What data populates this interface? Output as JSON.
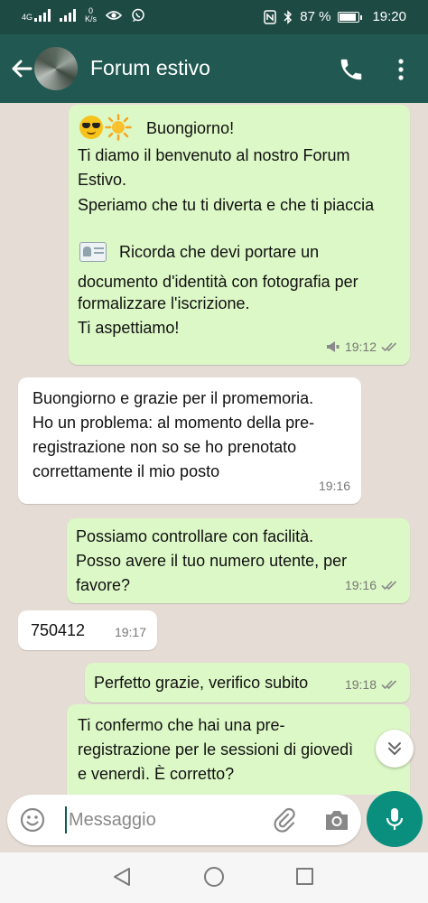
{
  "status_bar": {
    "network_label": "4G",
    "speed_value": "0",
    "speed_unit": "K/s",
    "battery_percent": "87 %",
    "battery_level": 0.87,
    "time": "19:20"
  },
  "header": {
    "title": "Forum estivo"
  },
  "messages": [
    {
      "direction": "outgoing",
      "lines": [
        "Buongiorno!",
        "Ti diamo il benvenuto al nostro Forum",
        "Estivo.",
        "Speriamo che tu ti diverta e che ti piaccia",
        "",
        "Ricorda che devi portare un",
        "documento d'identità con fotografia per",
        "formalizzare l'iscrizione.",
        "Ti aspettiamo!"
      ],
      "time": "19:12",
      "status": "read"
    },
    {
      "direction": "incoming",
      "lines": [
        "Buongiorno e grazie per il promemoria.",
        "Ho un problema: al momento della pre-",
        "registrazione non so se ho prenotato",
        "correttamente il mio posto"
      ],
      "time": "19:16"
    },
    {
      "direction": "outgoing",
      "lines": [
        "Possiamo controllare con facilità.",
        "Posso avere il tuo numero utente, per",
        "favore?"
      ],
      "time": "19:16",
      "status": "read"
    },
    {
      "direction": "incoming",
      "lines": [
        "750412"
      ],
      "time": "19:17"
    },
    {
      "direction": "outgoing",
      "lines": [
        "Perfetto grazie, verifico subito"
      ],
      "time": "19:18",
      "status": "read"
    },
    {
      "direction": "outgoing",
      "lines": [
        "Ti confermo che hai una pre-",
        "registrazione per le sessioni di giovedì",
        "e venerdì. È corretto?"
      ],
      "time": "",
      "status": ""
    }
  ],
  "composer": {
    "placeholder": "Messaggio"
  },
  "colors": {
    "header": "#215952",
    "outgoing_bubble": "#dcf8c6",
    "incoming_bubble": "#ffffff",
    "chat_background": "#e5ddd5",
    "read_ticks": "#4fc3f7",
    "accent": "#0a8f7f"
  }
}
